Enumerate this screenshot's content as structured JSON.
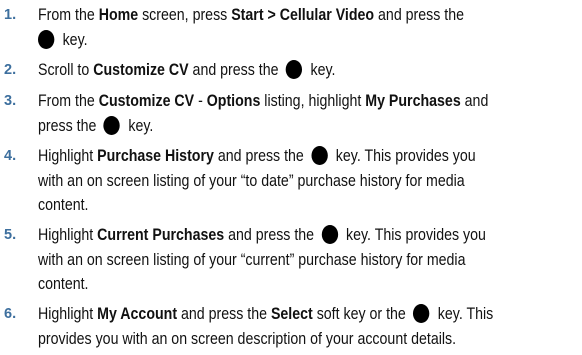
{
  "steps": [
    {
      "num": "1.",
      "parts": [
        {
          "t": "From the "
        },
        {
          "t": "Home",
          "b": true
        },
        {
          "t": " screen, press "
        },
        {
          "t": "Start > Cellular Video",
          "b": true
        },
        {
          "t": " and press the"
        },
        {
          "br": true
        },
        {
          "key": true,
          "first": true
        },
        {
          "t": " key."
        }
      ]
    },
    {
      "num": "2.",
      "parts": [
        {
          "t": "Scroll to "
        },
        {
          "t": "Customize CV",
          "b": true
        },
        {
          "t": " and press the "
        },
        {
          "key": true
        },
        {
          "t": " key."
        }
      ]
    },
    {
      "num": "3.",
      "parts": [
        {
          "t": "From the "
        },
        {
          "t": "Customize CV",
          "b": true
        },
        {
          "t": " - "
        },
        {
          "t": "Options",
          "b": true
        },
        {
          "t": " listing, highlight "
        },
        {
          "t": "My Purchases",
          "b": true
        },
        {
          "t": " and"
        },
        {
          "br": true
        },
        {
          "t": "press the "
        },
        {
          "key": true
        },
        {
          "t": " key."
        }
      ]
    },
    {
      "num": "4.",
      "parts": [
        {
          "t": "Highlight "
        },
        {
          "t": "Purchase History",
          "b": true
        },
        {
          "t": " and press the "
        },
        {
          "key": true
        },
        {
          "t": " key. This provides you"
        },
        {
          "br": true
        },
        {
          "t": "with an on screen listing of your “to date” purchase history for media"
        },
        {
          "br": true
        },
        {
          "t": "content."
        }
      ]
    },
    {
      "num": "5.",
      "parts": [
        {
          "t": "Highlight "
        },
        {
          "t": "Current Purchases",
          "b": true
        },
        {
          "t": " and press the "
        },
        {
          "key": true
        },
        {
          "t": " key. This provides you"
        },
        {
          "br": true
        },
        {
          "t": "with an on screen listing of your “current” purchase history for media"
        },
        {
          "br": true
        },
        {
          "t": "content."
        }
      ]
    },
    {
      "num": "6.",
      "parts": [
        {
          "t": "Highlight "
        },
        {
          "t": "My Account",
          "b": true
        },
        {
          "t": " and press the "
        },
        {
          "t": "Select",
          "b": true
        },
        {
          "t": " soft key or the "
        },
        {
          "key": true
        },
        {
          "t": " key. This"
        },
        {
          "br": true
        },
        {
          "t": "provides you with an on screen description of your account details."
        }
      ]
    }
  ]
}
